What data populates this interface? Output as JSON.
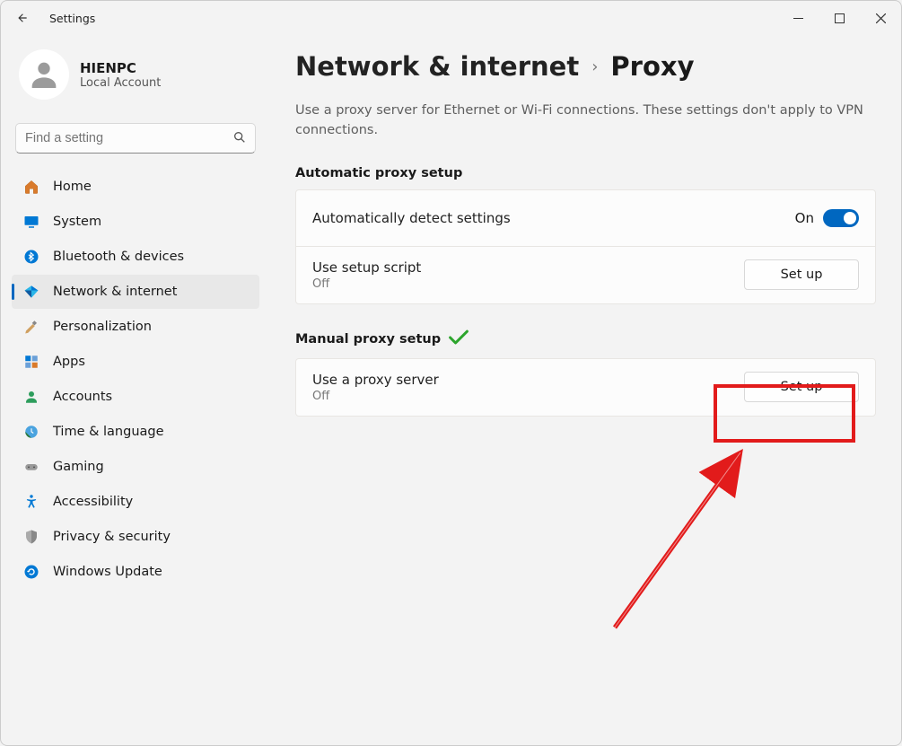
{
  "titlebar": {
    "app_name": "Settings"
  },
  "profile": {
    "name": "HIENPC",
    "sub": "Local Account"
  },
  "search": {
    "placeholder": "Find a setting"
  },
  "nav": {
    "items": [
      {
        "label": "Home"
      },
      {
        "label": "System"
      },
      {
        "label": "Bluetooth & devices"
      },
      {
        "label": "Network & internet"
      },
      {
        "label": "Personalization"
      },
      {
        "label": "Apps"
      },
      {
        "label": "Accounts"
      },
      {
        "label": "Time & language"
      },
      {
        "label": "Gaming"
      },
      {
        "label": "Accessibility"
      },
      {
        "label": "Privacy & security"
      },
      {
        "label": "Windows Update"
      }
    ]
  },
  "breadcrumb": {
    "parent": "Network & internet",
    "current": "Proxy"
  },
  "description": "Use a proxy server for Ethernet or Wi-Fi connections. These settings don't apply to VPN connections.",
  "sections": {
    "auto": {
      "title": "Automatic proxy setup",
      "detect": {
        "label": "Automatically detect settings",
        "state": "On"
      },
      "script": {
        "label": "Use setup script",
        "state": "Off",
        "button": "Set up"
      }
    },
    "manual": {
      "title": "Manual proxy setup",
      "proxy": {
        "label": "Use a proxy server",
        "state": "Off",
        "button": "Set up"
      }
    }
  }
}
